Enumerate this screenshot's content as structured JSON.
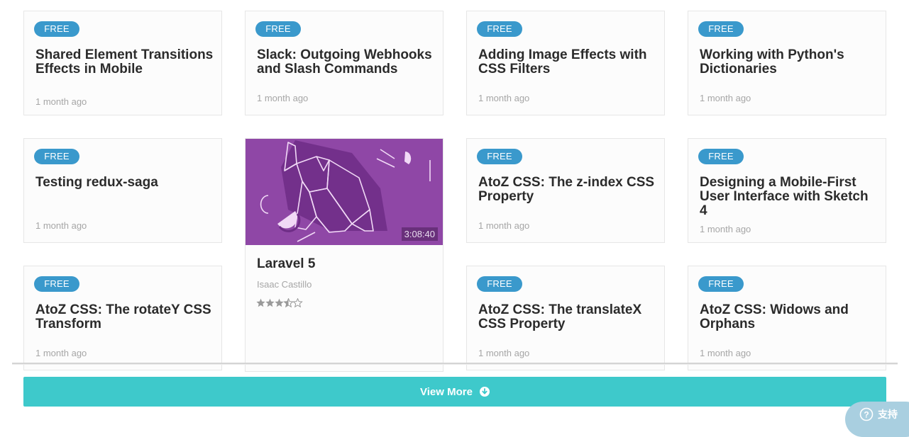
{
  "cards": [
    {
      "badge": "FREE",
      "title": "Shared Element Transitions Effects in Mobile",
      "time": "1 month ago"
    },
    {
      "badge": "FREE",
      "title": "Slack: Outgoing Webhooks and Slash Commands",
      "time": "1 month ago"
    },
    {
      "badge": "FREE",
      "title": "Adding Image Effects with CSS Filters",
      "time": "1 month ago"
    },
    {
      "badge": "FREE",
      "title": "Working with Python's Dictionaries",
      "time": "1 month ago"
    },
    {
      "badge": "FREE",
      "title": "Testing redux-saga",
      "time": "1 month ago"
    },
    {
      "badge": "FREE",
      "title": "AtoZ CSS: The z-index CSS Property",
      "time": "1 month ago"
    },
    {
      "badge": "FREE",
      "title": "Designing a Mobile-First User Interface with Sketch 4",
      "time": "1 month ago"
    },
    {
      "badge": "FREE",
      "title": "AtoZ CSS: The rotateY CSS Transform",
      "time": "1 month ago"
    },
    {
      "badge": "FREE",
      "title": "AtoZ CSS: The translateX CSS Property",
      "time": "1 month ago"
    },
    {
      "badge": "FREE",
      "title": "AtoZ CSS: Widows and Orphans",
      "time": "1 month ago"
    }
  ],
  "featured": {
    "title": "Laravel 5",
    "author": "Isaac Castillo",
    "duration": "3:08:40",
    "rating": 3.5,
    "rating_max": 5
  },
  "view_more": {
    "label": "View More",
    "icon": "arrow-circle-down-icon"
  },
  "support": {
    "label": "支持",
    "icon": "help-circle-icon"
  },
  "colors": {
    "badge": "#3a99cc",
    "view_more": "#3ec9cb",
    "thumb": "#8f47a6",
    "support": "#a9cfe0"
  }
}
